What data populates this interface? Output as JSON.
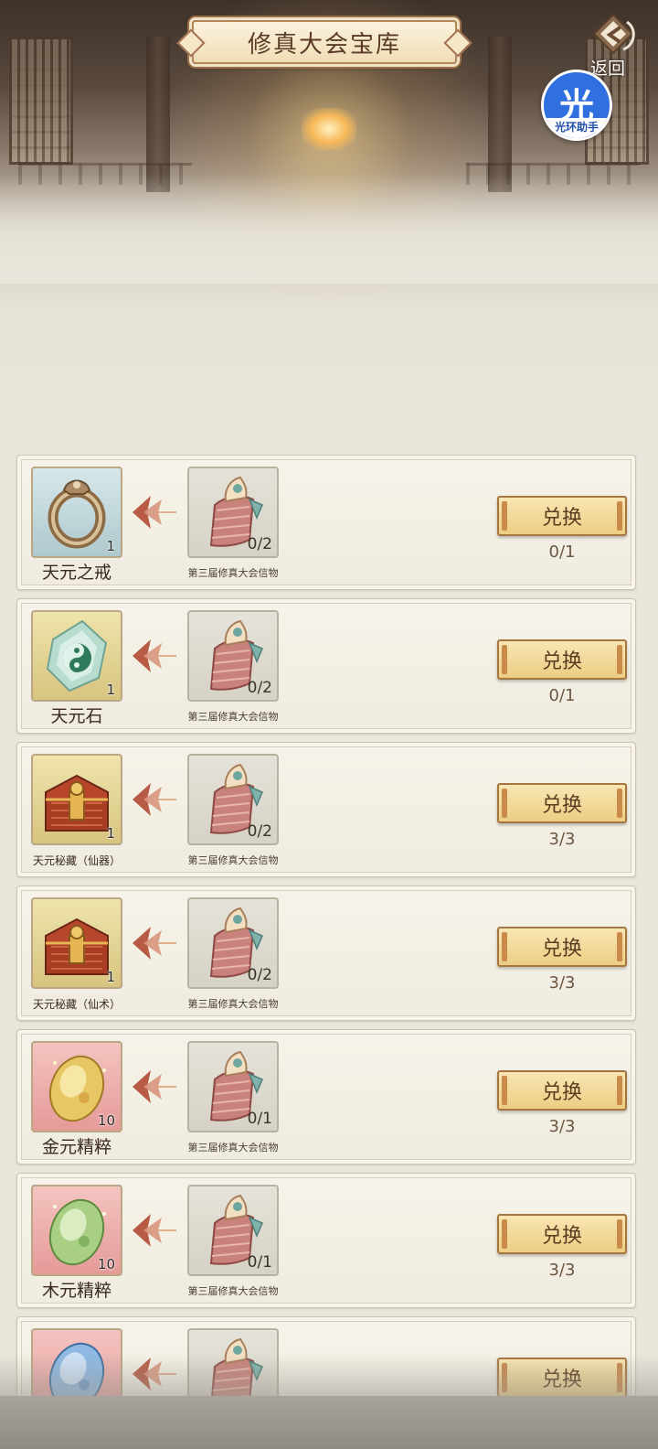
{
  "header": {
    "title": "修真大会宝库",
    "back_label": "返回"
  },
  "assistant": {
    "char": "光",
    "label": "光环助手"
  },
  "exchange_items": [
    {
      "reward": {
        "name": "天元之戒",
        "count": "1",
        "icon": "ring-icon",
        "frame": "blue"
      },
      "cost": {
        "name": "第三届修真大会信物",
        "count": "0/2",
        "icon": "token-icon"
      },
      "button": "兑换",
      "limit": "0/1"
    },
    {
      "reward": {
        "name": "天元石",
        "count": "1",
        "icon": "jade-stone-icon",
        "frame": "gold"
      },
      "cost": {
        "name": "第三届修真大会信物",
        "count": "0/2",
        "icon": "token-icon"
      },
      "button": "兑换",
      "limit": "0/1"
    },
    {
      "reward": {
        "name": "天元秘藏（仙器）",
        "count": "1",
        "icon": "treasure-chest-icon",
        "frame": "gold"
      },
      "cost": {
        "name": "第三届修真大会信物",
        "count": "0/2",
        "icon": "token-icon"
      },
      "button": "兑换",
      "limit": "3/3"
    },
    {
      "reward": {
        "name": "天元秘藏（仙术）",
        "count": "1",
        "icon": "treasure-chest-icon",
        "frame": "gold"
      },
      "cost": {
        "name": "第三届修真大会信物",
        "count": "0/2",
        "icon": "token-icon"
      },
      "button": "兑换",
      "limit": "3/3"
    },
    {
      "reward": {
        "name": "金元精粹",
        "count": "10",
        "icon": "gold-essence-icon",
        "frame": "red"
      },
      "cost": {
        "name": "第三届修真大会信物",
        "count": "0/1",
        "icon": "token-icon"
      },
      "button": "兑换",
      "limit": "3/3"
    },
    {
      "reward": {
        "name": "木元精粹",
        "count": "10",
        "icon": "wood-essence-icon",
        "frame": "red"
      },
      "cost": {
        "name": "第三届修真大会信物",
        "count": "0/1",
        "icon": "token-icon"
      },
      "button": "兑换",
      "limit": "3/3"
    },
    {
      "reward": {
        "name": "",
        "count": "",
        "icon": "water-essence-icon",
        "frame": "red"
      },
      "cost": {
        "name": "",
        "count": "",
        "icon": "token-icon"
      },
      "button": "兑换",
      "limit": ""
    }
  ]
}
